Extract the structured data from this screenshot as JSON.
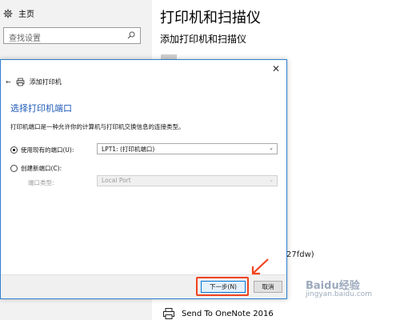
{
  "settings": {
    "home_label": "主页",
    "search_placeholder": "查找设置",
    "title": "打印机和扫描仪",
    "subtitle": "添加打印机和扫描仪",
    "partial_text": "27fdw)",
    "onenote_label": "Send To OneNote 2016"
  },
  "dialog": {
    "wizard_title": "添加打印机",
    "heading": "选择打印机端口",
    "description": "打印机端口是一种允许你的计算机与打印机交换信息的连接类型。",
    "existing_port_label": "使用现有的端口(U):",
    "existing_port_value": "LPT1: (打印机端口)",
    "new_port_label": "创建新端口(C):",
    "port_type_label": "端口类型:",
    "port_type_value": "Local Port",
    "next_button": "下一步(N)",
    "cancel_button": "取消",
    "selected_option": "existing"
  },
  "watermark": {
    "line1": "Baidu经验",
    "line2": "jingyan.baidu.com"
  },
  "colors": {
    "accent": "#1e5bb8",
    "dialog_border": "#2f7fd0",
    "highlight": "#f0431f"
  }
}
